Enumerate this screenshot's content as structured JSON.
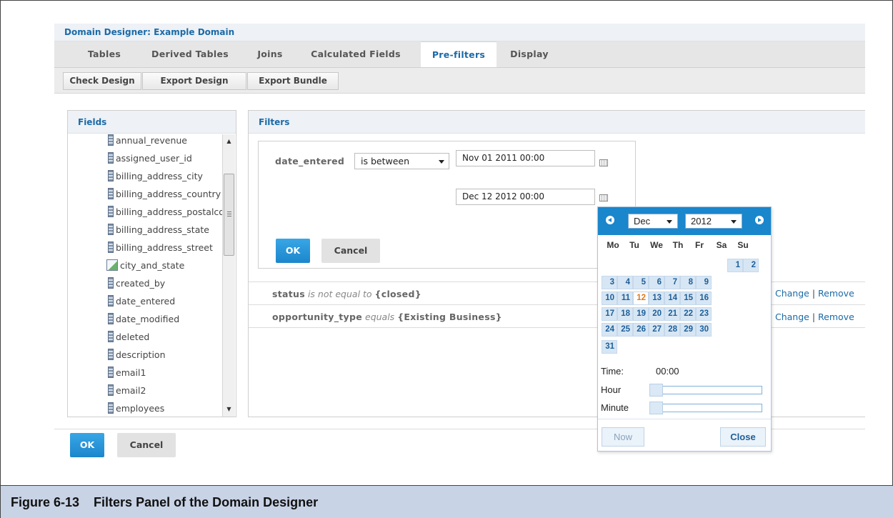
{
  "app": {
    "title": "Domain Designer: Example Domain"
  },
  "tabs": [
    {
      "label": "Tables"
    },
    {
      "label": "Derived Tables"
    },
    {
      "label": "Joins"
    },
    {
      "label": "Calculated Fields"
    },
    {
      "label": "Pre-filters",
      "active": true
    },
    {
      "label": "Display"
    }
  ],
  "toolbar": {
    "check_design": "Check Design",
    "export_design": "Export Design",
    "export_bundle": "Export Bundle"
  },
  "fields_panel": {
    "title": "Fields",
    "items": [
      {
        "label": "annual_revenue",
        "icon": "field-icon"
      },
      {
        "label": "assigned_user_id",
        "icon": "field-icon"
      },
      {
        "label": "billing_address_city",
        "icon": "field-icon"
      },
      {
        "label": "billing_address_country",
        "icon": "field-icon"
      },
      {
        "label": "billing_address_postalcode",
        "icon": "field-icon"
      },
      {
        "label": "billing_address_state",
        "icon": "field-icon"
      },
      {
        "label": "billing_address_street",
        "icon": "field-icon"
      },
      {
        "label": "city_and_state",
        "icon": "calculated-field-icon"
      },
      {
        "label": "created_by",
        "icon": "field-icon"
      },
      {
        "label": "date_entered",
        "icon": "field-icon"
      },
      {
        "label": "date_modified",
        "icon": "field-icon"
      },
      {
        "label": "deleted",
        "icon": "field-icon"
      },
      {
        "label": "description",
        "icon": "field-icon"
      },
      {
        "label": "email1",
        "icon": "field-icon"
      },
      {
        "label": "email2",
        "icon": "field-icon"
      },
      {
        "label": "employees",
        "icon": "field-icon"
      }
    ]
  },
  "filters_panel": {
    "title": "Filters",
    "editor": {
      "field": "date_entered",
      "operator": "is between",
      "start_value": "Nov 01 2011 00:00",
      "end_value": "Dec 12 2012 00:00",
      "ok": "OK",
      "cancel": "Cancel"
    },
    "rows": [
      {
        "field": "status",
        "op": "is not equal to",
        "value": "{closed}",
        "change": "Change",
        "remove": "Remove",
        "sep": "|"
      },
      {
        "field": "opportunity_type",
        "op": "equals",
        "value": "{Existing Business}",
        "change": "Change",
        "remove": "Remove",
        "sep": "|"
      }
    ]
  },
  "calendar": {
    "month": "Dec",
    "year": "2012",
    "weekdays": [
      "Mo",
      "Tu",
      "We",
      "Th",
      "Fr",
      "Sa",
      "Su"
    ],
    "days": [
      "1",
      "2",
      "3",
      "4",
      "5",
      "6",
      "7",
      "8",
      "9",
      "10",
      "11",
      "12",
      "13",
      "14",
      "15",
      "16",
      "17",
      "18",
      "19",
      "20",
      "21",
      "22",
      "23",
      "24",
      "25",
      "26",
      "27",
      "28",
      "29",
      "30",
      "31"
    ],
    "selected_day": "12",
    "time_label": "Time:",
    "time_value": "00:00",
    "hour_label": "Hour",
    "minute_label": "Minute",
    "hour_value": 0,
    "minute_value": 0,
    "now": "Now",
    "close": "Close"
  },
  "footer": {
    "ok": "OK",
    "cancel": "Cancel"
  },
  "caption": {
    "number": "Figure 6-13",
    "text": "Filters Panel of the Domain Designer"
  },
  "colors": {
    "accent": "#1a86cc",
    "title_text": "#1a6aa8",
    "caption_bg": "#c8d3e6",
    "today": "#e07a1a"
  }
}
